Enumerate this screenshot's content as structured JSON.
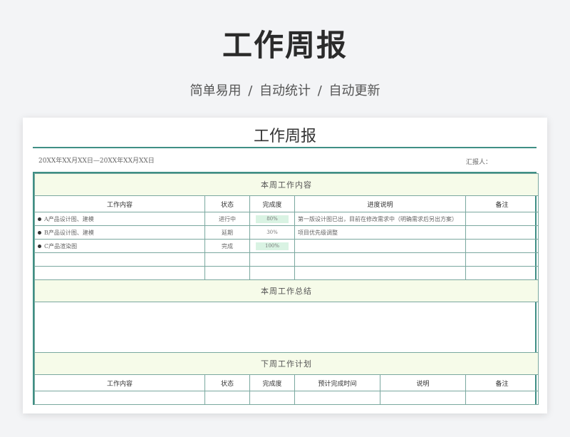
{
  "hero": {
    "title": "工作周报",
    "subtitle": "简单易用  /  自动统计  /  自动更新"
  },
  "doc": {
    "title": "工作周报",
    "date_range": "20XX年XX月XX日—20XX年XX月XX日",
    "reporter_label": "汇报人："
  },
  "this_week": {
    "section_title": "本周工作内容",
    "headers": [
      "工作内容",
      "状态",
      "完成度",
      "进度说明",
      "备注"
    ],
    "rows": [
      {
        "task": "A产品设计图、建模",
        "status": "进行中",
        "progress": "80%",
        "note": "第一版设计图已出，目前在修改需求中（明确需求后另出方案）",
        "remark": ""
      },
      {
        "task": "B产品设计图、建模",
        "status": "延期",
        "progress": "30%",
        "note": "项目优先级调整",
        "remark": ""
      },
      {
        "task": "C产品渲染图",
        "status": "完成",
        "progress": "100%",
        "note": "",
        "remark": ""
      }
    ]
  },
  "summary": {
    "section_title": "本周工作总结"
  },
  "next_week": {
    "section_title": "下周工作计划",
    "headers": [
      "工作内容",
      "状态",
      "完成度",
      "预计完成时间",
      "说明",
      "备注"
    ]
  },
  "colors": {
    "accent": "#3f8f85",
    "band": "#f6fbe9",
    "progress_fill": "#d9f3e3"
  }
}
